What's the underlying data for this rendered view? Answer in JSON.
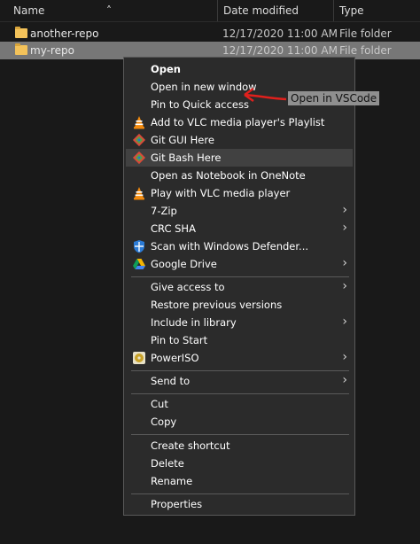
{
  "header": {
    "name_label": "Name",
    "date_label": "Date modified",
    "type_label": "Type"
  },
  "files": [
    {
      "name": "another-repo",
      "date": "12/17/2020 11:00 AM",
      "type": "File folder",
      "selected": false
    },
    {
      "name": "my-repo",
      "date": "12/17/2020 11:00 AM",
      "type": "File folder",
      "selected": true
    }
  ],
  "menu": {
    "open": "Open",
    "open_new_window": "Open in new window",
    "pin_quick_access": "Pin to Quick access",
    "vlc_playlist": "Add to VLC media player's Playlist",
    "git_gui": "Git GUI Here",
    "git_bash": "Git Bash Here",
    "onenote": "Open as Notebook in OneNote",
    "vlc_play": "Play with VLC media player",
    "zip": "7-Zip",
    "crc": "CRC SHA",
    "defender": "Scan with Windows Defender...",
    "gdrive": "Google Drive",
    "give_access": "Give access to",
    "restore_versions": "Restore previous versions",
    "include_library": "Include in library",
    "pin_start": "Pin to Start",
    "poweriso": "PowerISO",
    "send_to": "Send to",
    "cut": "Cut",
    "copy": "Copy",
    "create_shortcut": "Create shortcut",
    "delete": "Delete",
    "rename": "Rename",
    "properties": "Properties"
  },
  "annotation": {
    "label": "Open in VSCode",
    "arrow_color": "#e0201c"
  },
  "colors": {
    "background": "#191919",
    "menu_bg": "#2b2b2b",
    "highlight": "#414141",
    "selected_row": "#777777"
  }
}
